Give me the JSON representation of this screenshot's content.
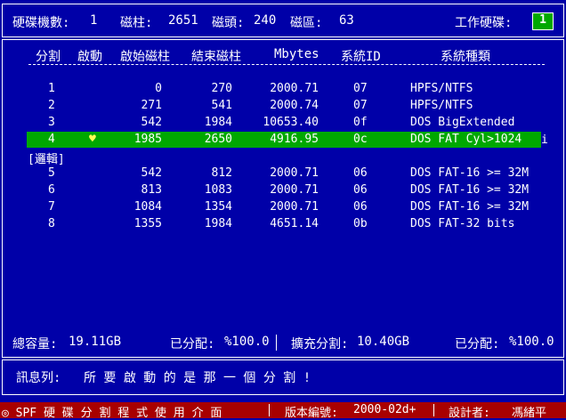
{
  "top": {
    "disk_count_label": "硬碟機數:",
    "disk_count": "1",
    "cylinders_label": "磁柱:",
    "cylinders": "2651",
    "heads_label": "磁頭:",
    "heads": "240",
    "sectors_label": "磁區:",
    "sectors": "63",
    "work_disk_label": "工作硬碟:",
    "work_disk": "1"
  },
  "table": {
    "headers": [
      "分割",
      "啟動",
      "啟始磁柱",
      "結束磁柱",
      "Mbytes",
      "系統ID",
      "系統種類"
    ],
    "rows": [
      {
        "num": "1",
        "boot": "",
        "start": "0",
        "end": "270",
        "mb": "2000.71",
        "sid": "07",
        "type": "HPFS/NTFS"
      },
      {
        "num": "2",
        "boot": "",
        "start": "271",
        "end": "541",
        "mb": "2000.74",
        "sid": "07",
        "type": "HPFS/NTFS"
      },
      {
        "num": "3",
        "boot": "",
        "start": "542",
        "end": "1984",
        "mb": "10653.40",
        "sid": "0f",
        "type": "DOS BigExtended"
      },
      {
        "num": "4",
        "boot": "♥",
        "start": "1985",
        "end": "2650",
        "mb": "4916.95",
        "sid": "0c",
        "type": "DOS FAT Cyl>1024"
      },
      {
        "num": "5",
        "boot": "",
        "start": "542",
        "end": "812",
        "mb": "2000.71",
        "sid": "06",
        "type": "DOS FAT-16 >= 32M"
      },
      {
        "num": "6",
        "boot": "",
        "start": "813",
        "end": "1083",
        "mb": "2000.71",
        "sid": "06",
        "type": "DOS FAT-16 >= 32M"
      },
      {
        "num": "7",
        "boot": "",
        "start": "1084",
        "end": "1354",
        "mb": "2000.71",
        "sid": "06",
        "type": "DOS FAT-16 >= 32M"
      },
      {
        "num": "8",
        "boot": "",
        "start": "1355",
        "end": "1984",
        "mb": "4651.14",
        "sid": "0b",
        "type": "DOS FAT-32 bits"
      }
    ],
    "selected_marker": "i",
    "logical_label": "[邏輯]"
  },
  "summary": {
    "total_label": "總容量:",
    "total": "19.11GB",
    "alloc1_label": "已分配:",
    "alloc1": "%100.0",
    "ext_label": "擴充分割:",
    "ext": "10.40GB",
    "alloc2_label": "已分配:",
    "alloc2": "%100.0"
  },
  "message": {
    "label": "訊息列:",
    "text": "所 要 啟 動 的 是 那 一 個 分 割 !"
  },
  "footer": {
    "app": "◎ SPF 硬 碟 分 割 程 式 使 用 介 面",
    "version_label": "版本編號:",
    "version": "2000-02d+",
    "designer_label": "設計者:",
    "designer": "馮緒平"
  },
  "colors": {
    "bg": "#0000a8",
    "highlight": "#00a800",
    "footer": "#a80000"
  }
}
